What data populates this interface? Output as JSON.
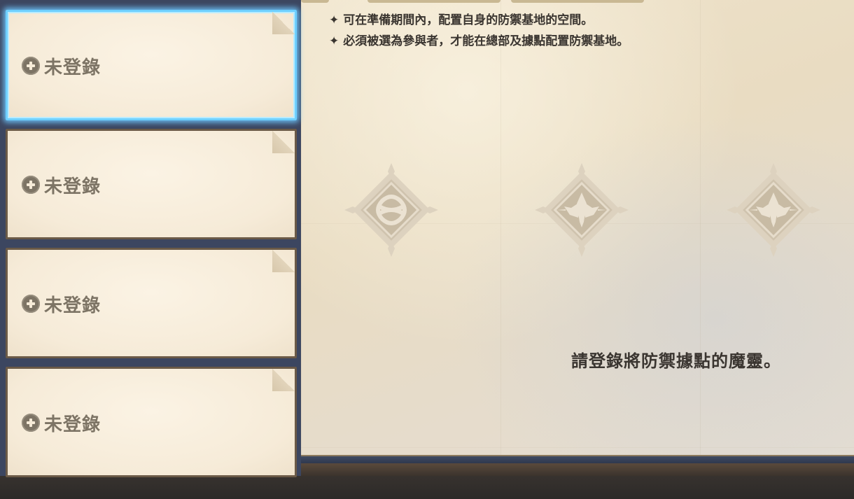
{
  "notes": [
    "可在準備期間內，配置自身的防禦基地的空間。",
    "必須被選為參與者，才能在總部及據點配置防禦基地。"
  ],
  "note_bullet": "✦",
  "slots": [
    {
      "label": "未登錄",
      "selected": true
    },
    {
      "label": "未登錄",
      "selected": false
    },
    {
      "label": "未登錄",
      "selected": false
    },
    {
      "label": "未登錄",
      "selected": false
    }
  ],
  "emblems": [
    {
      "icon": "knot-emblem-icon"
    },
    {
      "icon": "wing-flame-emblem-icon"
    },
    {
      "icon": "wing-flame-emblem-icon"
    }
  ],
  "prompt_text": "請登錄將防禦據點的魔靈。",
  "colors": {
    "selected_border": "#6fd0ff",
    "card_bg": "#f6ebd8",
    "label": "#7d7465",
    "frame": "#3c4660"
  }
}
